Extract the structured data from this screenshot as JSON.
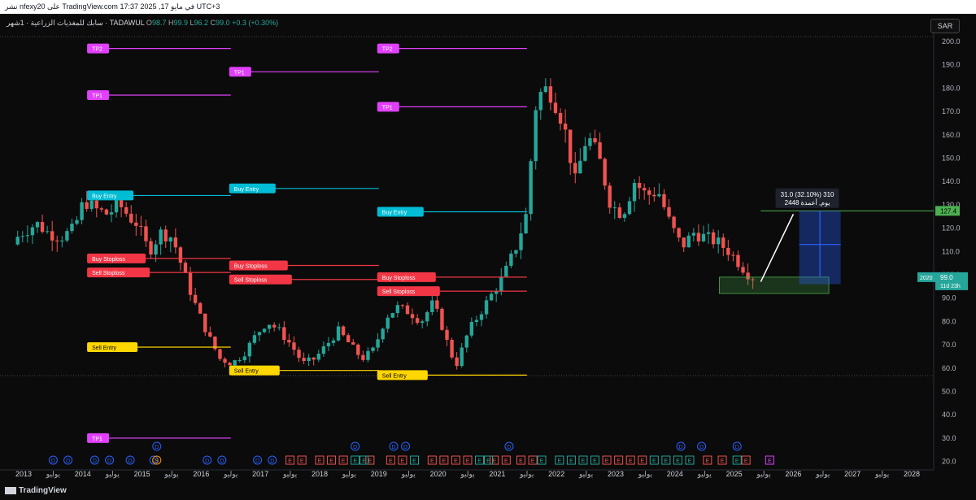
{
  "header": {
    "publish_line": "نشر nfexy20 على TradingView.com في مايو 17, 2025 17:37 UTC+3"
  },
  "symbol": {
    "name": "سابك للمغذيات الزراعية · 1شهر · TADAWUL",
    "o_label": "O",
    "o_value": "98.7",
    "h_label": "H",
    "h_value": "99.9",
    "l_label": "L",
    "l_value": "96.2",
    "c_label": "C",
    "c_value": "99.0",
    "change": "+0.3 (+0.30%)"
  },
  "currency_button": "SAR",
  "logo_text": "TradingView",
  "colors": {
    "up": "#26a69a",
    "down": "#ef5350",
    "tp": "#e040fb",
    "buy_entry": "#00bcd4",
    "stoploss": "#f23645",
    "sell_entry": "#ffd600",
    "target": "#4caf50",
    "projection": "#2962ff"
  },
  "chart_data": {
    "type": "candlestick",
    "y_axis": {
      "min": 20,
      "max": 200,
      "ticks": [
        "200.0",
        "190.0",
        "180.0",
        "170.0",
        "160.0",
        "150.0",
        "140.0",
        "130.0",
        "120.0",
        "110.0",
        "100.0",
        "90.0",
        "80.0",
        "70.0",
        "60.0",
        "50.0",
        "40.0",
        "30.0",
        "20.0"
      ]
    },
    "x_axis": {
      "labels": [
        {
          "t": 2013.0,
          "text": "2013"
        },
        {
          "t": 2013.5,
          "text": "يوليو"
        },
        {
          "t": 2014.0,
          "text": "2014"
        },
        {
          "t": 2014.5,
          "text": "يوليو"
        },
        {
          "t": 2015.0,
          "text": "2015"
        },
        {
          "t": 2015.5,
          "text": "يوليو"
        },
        {
          "t": 2016.0,
          "text": "2016"
        },
        {
          "t": 2016.5,
          "text": "يوليو"
        },
        {
          "t": 2017.0,
          "text": "2017"
        },
        {
          "t": 2017.5,
          "text": "يوليو"
        },
        {
          "t": 2018.0,
          "text": "2018"
        },
        {
          "t": 2018.5,
          "text": "يوليو"
        },
        {
          "t": 2019.0,
          "text": "2019"
        },
        {
          "t": 2019.5,
          "text": "يوليو"
        },
        {
          "t": 2020.0,
          "text": "2020"
        },
        {
          "t": 2020.5,
          "text": "يوليو"
        },
        {
          "t": 2021.0,
          "text": "2021"
        },
        {
          "t": 2021.5,
          "text": "يوليو"
        },
        {
          "t": 2022.0,
          "text": "2022"
        },
        {
          "t": 2022.5,
          "text": "يوليو"
        },
        {
          "t": 2023.0,
          "text": "2023"
        },
        {
          "t": 2023.5,
          "text": "يوليو"
        },
        {
          "t": 2024.0,
          "text": "2024"
        },
        {
          "t": 2024.5,
          "text": "يوليو"
        },
        {
          "t": 2025.0,
          "text": "2025"
        },
        {
          "t": 2025.5,
          "text": "يوليو"
        },
        {
          "t": 2026.0,
          "text": "2026"
        },
        {
          "t": 2026.5,
          "text": "يوليو"
        },
        {
          "t": 2027.0,
          "text": "2027"
        },
        {
          "t": 2027.5,
          "text": "يوليو"
        },
        {
          "t": 2028.0,
          "text": "2028"
        }
      ]
    },
    "anchor_points": [
      [
        2012.9,
        113
      ],
      [
        2013.0,
        117
      ],
      [
        2013.3,
        122
      ],
      [
        2013.5,
        118
      ],
      [
        2013.7,
        116
      ],
      [
        2013.9,
        119
      ],
      [
        2014.0,
        124
      ],
      [
        2014.1,
        132
      ],
      [
        2014.3,
        128
      ],
      [
        2014.5,
        126
      ],
      [
        2014.7,
        130
      ],
      [
        2014.9,
        124
      ],
      [
        2015.0,
        122
      ],
      [
        2015.2,
        110
      ],
      [
        2015.4,
        118
      ],
      [
        2015.6,
        116
      ],
      [
        2015.8,
        100
      ],
      [
        2016.0,
        86
      ],
      [
        2016.2,
        74
      ],
      [
        2016.4,
        64
      ],
      [
        2016.6,
        62
      ],
      [
        2016.8,
        66
      ],
      [
        2017.0,
        74
      ],
      [
        2017.2,
        80
      ],
      [
        2017.4,
        76
      ],
      [
        2017.6,
        70
      ],
      [
        2017.8,
        62
      ],
      [
        2018.0,
        64
      ],
      [
        2018.2,
        70
      ],
      [
        2018.4,
        76
      ],
      [
        2018.6,
        70
      ],
      [
        2018.8,
        64
      ],
      [
        2019.0,
        68
      ],
      [
        2019.2,
        82
      ],
      [
        2019.4,
        86
      ],
      [
        2019.6,
        84
      ],
      [
        2019.8,
        80
      ],
      [
        2020.0,
        88
      ],
      [
        2020.15,
        78
      ],
      [
        2020.3,
        66
      ],
      [
        2020.4,
        62
      ],
      [
        2020.6,
        76
      ],
      [
        2020.8,
        84
      ],
      [
        2021.0,
        92
      ],
      [
        2021.2,
        100
      ],
      [
        2021.4,
        112
      ],
      [
        2021.6,
        128
      ],
      [
        2021.7,
        170
      ],
      [
        2021.85,
        180
      ],
      [
        2022.0,
        178
      ],
      [
        2022.2,
        165
      ],
      [
        2022.4,
        140
      ],
      [
        2022.6,
        160
      ],
      [
        2022.8,
        150
      ],
      [
        2023.0,
        130
      ],
      [
        2023.2,
        126
      ],
      [
        2023.4,
        140
      ],
      [
        2023.6,
        134
      ],
      [
        2023.8,
        136
      ],
      [
        2024.0,
        122
      ],
      [
        2024.2,
        112
      ],
      [
        2024.4,
        118
      ],
      [
        2024.6,
        116
      ],
      [
        2024.8,
        114
      ],
      [
        2025.0,
        110
      ],
      [
        2025.2,
        104
      ],
      [
        2025.37,
        99
      ]
    ],
    "last_price": "99.0",
    "last_price_tag": "2020",
    "countdown": "11d 23h",
    "target_price": "127.4",
    "measure": {
      "line1": "31.0 (32.10%) 310",
      "line2": "244يوم, أعمدة 8"
    },
    "levels": [
      {
        "label": "TP2",
        "price": 197,
        "x1": 2014.1,
        "x2": 2016.5,
        "color": "tp"
      },
      {
        "label": "TP1",
        "price": 177,
        "x1": 2014.1,
        "x2": 2016.5,
        "color": "tp"
      },
      {
        "label": "TP1",
        "price": 30,
        "x1": 2014.1,
        "x2": 2016.5,
        "color": "tp"
      },
      {
        "label": "Buy Entry",
        "price": 134,
        "x1": 2014.1,
        "x2": 2016.5,
        "color": "buy_entry"
      },
      {
        "label": "Buy Stoploss",
        "price": 107,
        "x1": 2014.1,
        "x2": 2016.5,
        "color": "stoploss"
      },
      {
        "label": "Sell Stoploss",
        "price": 101,
        "x1": 2014.1,
        "x2": 2016.5,
        "color": "stoploss"
      },
      {
        "label": "Sell Entry",
        "price": 69,
        "x1": 2014.1,
        "x2": 2016.5,
        "color": "sell_entry"
      },
      {
        "label": "TP1",
        "price": 187,
        "x1": 2016.5,
        "x2": 2019.0,
        "color": "tp"
      },
      {
        "label": "Buy Entry",
        "price": 137,
        "x1": 2016.5,
        "x2": 2019.0,
        "color": "buy_entry"
      },
      {
        "label": "Buy Stoploss",
        "price": 104,
        "x1": 2016.5,
        "x2": 2019.0,
        "color": "stoploss"
      },
      {
        "label": "Sell Stoploss",
        "price": 98,
        "x1": 2016.5,
        "x2": 2019.0,
        "color": "stoploss"
      },
      {
        "label": "Sell Entry",
        "price": 59,
        "x1": 2016.5,
        "x2": 2019.0,
        "color": "sell_entry"
      },
      {
        "label": "TP2",
        "price": 197,
        "x1": 2019.0,
        "x2": 2021.5,
        "color": "tp"
      },
      {
        "label": "TP1",
        "price": 172,
        "x1": 2019.0,
        "x2": 2021.5,
        "color": "tp"
      },
      {
        "label": "Buy Entry",
        "price": 127,
        "x1": 2019.0,
        "x2": 2021.5,
        "color": "buy_entry"
      },
      {
        "label": "Buy Stoploss",
        "price": 99,
        "x1": 2019.0,
        "x2": 2021.5,
        "color": "stoploss"
      },
      {
        "label": "Sell Stoploss",
        "price": 93,
        "x1": 2019.0,
        "x2": 2021.5,
        "color": "stoploss"
      },
      {
        "label": "Sell Entry",
        "price": 57,
        "x1": 2019.0,
        "x2": 2021.5,
        "color": "sell_entry"
      }
    ],
    "events": {
      "dividends_low": [
        2013.5,
        2013.75,
        2014.2,
        2014.45,
        2014.8,
        2015.2,
        2016.1,
        2016.35,
        2016.95,
        2017.2
      ],
      "dividends_high": [
        2015.25,
        2018.6,
        2019.25,
        2019.45,
        2021.2,
        2024.1,
        2024.45,
        2025.05
      ],
      "split": [
        2015.25
      ],
      "earnings_red": [
        2017.5,
        2017.7,
        2018.0,
        2018.2,
        2018.4,
        2018.85,
        2019.2,
        2019.4,
        2019.9,
        2020.1,
        2020.3,
        2020.5,
        2020.95,
        2021.15,
        2021.4,
        2021.6,
        2022.85,
        2023.05,
        2023.25,
        2023.45,
        2024.55,
        2024.8,
        2025.2
      ],
      "earnings_green": [
        2018.6,
        2018.75,
        2019.6,
        2020.7,
        2020.85,
        2021.75,
        2022.05,
        2022.25,
        2022.45,
        2022.65,
        2023.65,
        2023.85,
        2024.05,
        2024.25,
        2025.05
      ],
      "earnings_future": [
        2025.6
      ]
    }
  }
}
